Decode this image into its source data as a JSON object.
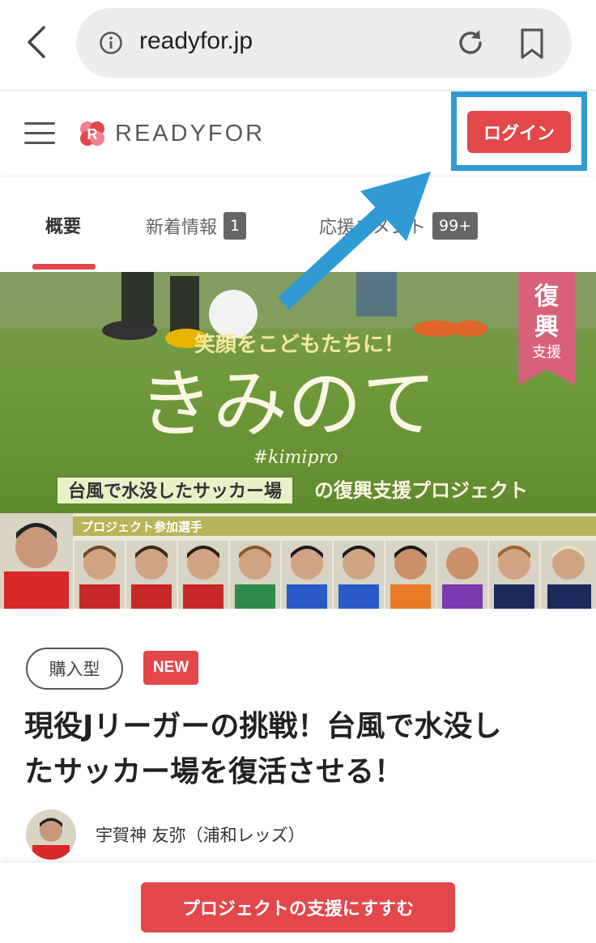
{
  "browser": {
    "url": "readyfor.jp",
    "back_icon": "chevron-left-icon",
    "info_icon": "info-icon",
    "reload_icon": "reload-icon",
    "bookmark_icon": "bookmark-icon"
  },
  "header": {
    "logo_text": "READYFOR",
    "login_label": "ログイン",
    "accent_color": "#e2474c",
    "highlight_color": "#2f9ad4"
  },
  "tabs": [
    {
      "label": "概要",
      "badge": null,
      "active": true
    },
    {
      "label": "新着情報",
      "badge": "1",
      "active": false
    },
    {
      "label": "応援コメント",
      "badge": "99+",
      "active": false
    }
  ],
  "hero": {
    "tagline": "笑顔をこどもたちに！",
    "main_title": "きみのて",
    "hashtag": "#kimipro",
    "subtitle_boxed": "台風で水没したサッカー場",
    "subtitle_rest": "の復興支援プロジェクト",
    "ribbon_line1": "復",
    "ribbon_line2": "興",
    "ribbon_line3": "支援",
    "players_label": "プロジェクト参加選手"
  },
  "project": {
    "type_tag": "購入型",
    "new_tag": "NEW",
    "title_line1": "現役Jリーガーの挑戦！台風で水没し",
    "title_line2": "たサッカー場を復活させる！",
    "author": "宇賀神 友弥（浦和レッズ）"
  },
  "footer": {
    "support_label": "プロジェクトの支援にすすむ"
  }
}
